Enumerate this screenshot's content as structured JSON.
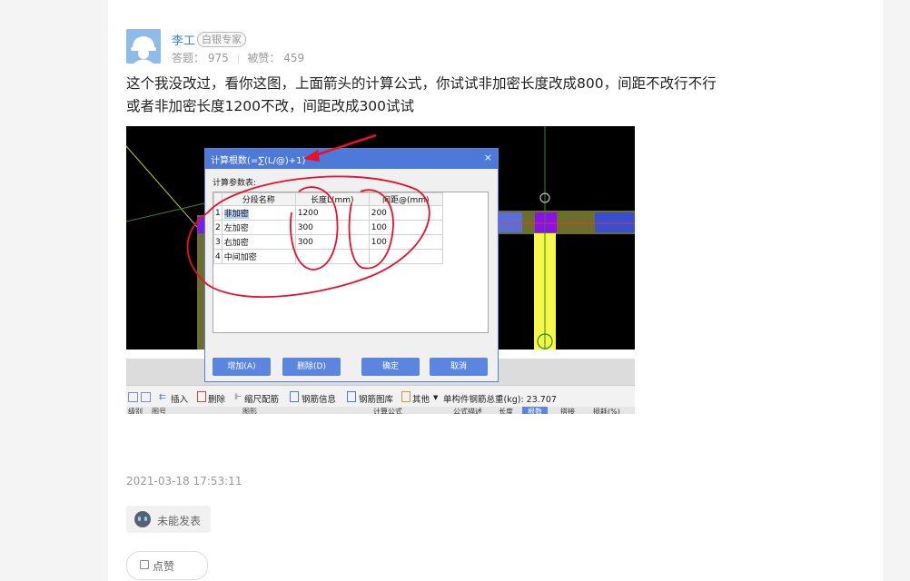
{
  "author": {
    "name": "李工",
    "badge": "白银专家",
    "answers_label": "答题：",
    "answers": "975",
    "likes_label": "被赞：",
    "likes": "459"
  },
  "answer_lines": [
    "这个我没改过，看你这图，上面箭头的计算公式，你试试非加密长度改成800，间距不改行不行",
    "或者非加密长度1200不改，间距改成300试试"
  ],
  "screenshot": {
    "dialog_title": "计算根数(=∑(L/@)+1)",
    "close_glyph": "×",
    "subtitle": "计算参数表:",
    "columns": [
      "分段名称",
      "长度L(mm)",
      "间距@(mm)"
    ],
    "rows": [
      {
        "n": "1",
        "name": "非加密",
        "length": "1200",
        "spacing": "200"
      },
      {
        "n": "2",
        "name": "左加密",
        "length": "300",
        "spacing": "100"
      },
      {
        "n": "3",
        "name": "右加密",
        "length": "300",
        "spacing": "100"
      },
      {
        "n": "4",
        "name": "中间加密",
        "length": "",
        "spacing": ""
      }
    ],
    "buttons": {
      "add": "增加(A)",
      "delete": "删除(D)",
      "ok": "确定",
      "cancel": "取消"
    },
    "toolbar": [
      "插入",
      "删除",
      "缩尺配筋",
      "钢筋信息",
      "钢筋图库",
      "其他",
      "单构件钢筋总重(kg): 23.707"
    ],
    "header_row": [
      "级别",
      "图号",
      "图形",
      "计算公式",
      "公式描述",
      "长度",
      "根数",
      "搭接",
      "损耗(%)"
    ]
  },
  "timestamp": "2021-03-18 17:53:11",
  "reaction_label": "未能发表",
  "bottom_button_label": "点赞"
}
